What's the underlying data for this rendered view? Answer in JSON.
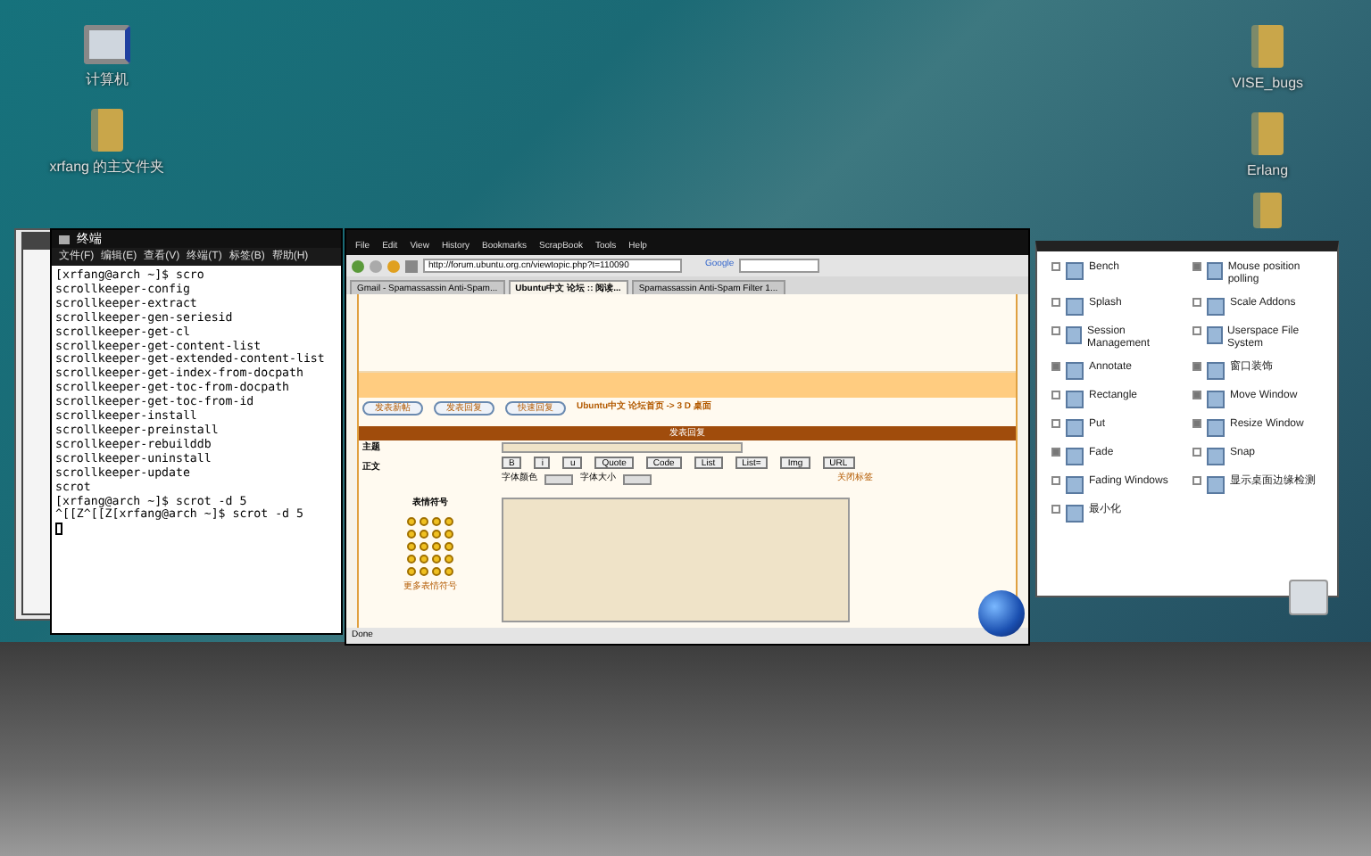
{
  "desktop_icons_left": [
    {
      "label": "计算机",
      "kind": "computer"
    },
    {
      "label": "xrfang 的主文件夹",
      "kind": "folder"
    }
  ],
  "desktop_icons_right": [
    {
      "label": "VISE_bugs",
      "kind": "folder"
    },
    {
      "label": "Erlang",
      "kind": "folder"
    }
  ],
  "terminal": {
    "title": "终端",
    "menu": [
      "文件(F)",
      "编辑(E)",
      "查看(V)",
      "终端(T)",
      "标签(B)",
      "帮助(H)"
    ],
    "lines": [
      "[xrfang@arch ~]$ scro",
      "scrollkeeper-config",
      "scrollkeeper-extract",
      "scrollkeeper-gen-seriesid",
      "scrollkeeper-get-cl",
      "scrollkeeper-get-content-list",
      "scrollkeeper-get-extended-content-list",
      "scrollkeeper-get-index-from-docpath",
      "scrollkeeper-get-toc-from-docpath",
      "scrollkeeper-get-toc-from-id",
      "scrollkeeper-install",
      "scrollkeeper-preinstall",
      "scrollkeeper-rebuilddb",
      "scrollkeeper-uninstall",
      "scrollkeeper-update",
      "scrot",
      "[xrfang@arch ~]$ scrot -d 5",
      "^[[Z^[[Z[xrfang@arch ~]$ scrot -d 5"
    ]
  },
  "browser": {
    "menu": [
      "File",
      "Edit",
      "View",
      "History",
      "Bookmarks",
      "ScrapBook",
      "Tools",
      "Help"
    ],
    "url": "http://forum.ubuntu.org.cn/viewtopic.php?t=110090",
    "search_engine": "Google",
    "tabs": [
      {
        "label": "Gmail - Spamassassin Anti-Spam...",
        "selected": false
      },
      {
        "label": "Ubuntu中文 论坛 :: 阅读...",
        "selected": true
      },
      {
        "label": "Spamassassin Anti-Spam Filter 1...",
        "selected": false
      }
    ],
    "forum_buttons": [
      "发表新帖",
      "发表回复",
      "快速回复"
    ],
    "breadcrumb": "Ubuntu中文 论坛首页 -> 3 D 桌面",
    "reply_header": "发表回复",
    "subject_label": "主题",
    "body_label": "正文",
    "smilies_label": "表情符号",
    "more_smilies": "更多表情符号",
    "format_buttons": [
      "B",
      "i",
      "u",
      "Quote",
      "Code",
      "List",
      "List=",
      "Img",
      "URL"
    ],
    "font_color_label": "字体颜色",
    "font_size_label": "字体大小",
    "close_tags": "关闭标签",
    "status": "Done"
  },
  "settings": {
    "items": [
      {
        "label": "Bench",
        "checked": false
      },
      {
        "label": "Mouse position polling",
        "checked": true
      },
      {
        "label": "Splash",
        "checked": false
      },
      {
        "label": "Scale Addons",
        "checked": false
      },
      {
        "label": "Session Management",
        "checked": false
      },
      {
        "label": "Userspace File System",
        "checked": false
      },
      {
        "label": "Annotate",
        "checked": true
      },
      {
        "label": "窗口装饰",
        "checked": true
      },
      {
        "label": "Rectangle",
        "checked": false
      },
      {
        "label": "Move Window",
        "checked": true
      },
      {
        "label": "Put",
        "checked": false
      },
      {
        "label": "Resize Window",
        "checked": true
      },
      {
        "label": "Fade",
        "checked": true
      },
      {
        "label": "Snap",
        "checked": false
      },
      {
        "label": "Fading Windows",
        "checked": false
      },
      {
        "label": "显示桌面边缘检测",
        "checked": false
      },
      {
        "label": "最小化",
        "checked": false
      }
    ]
  }
}
